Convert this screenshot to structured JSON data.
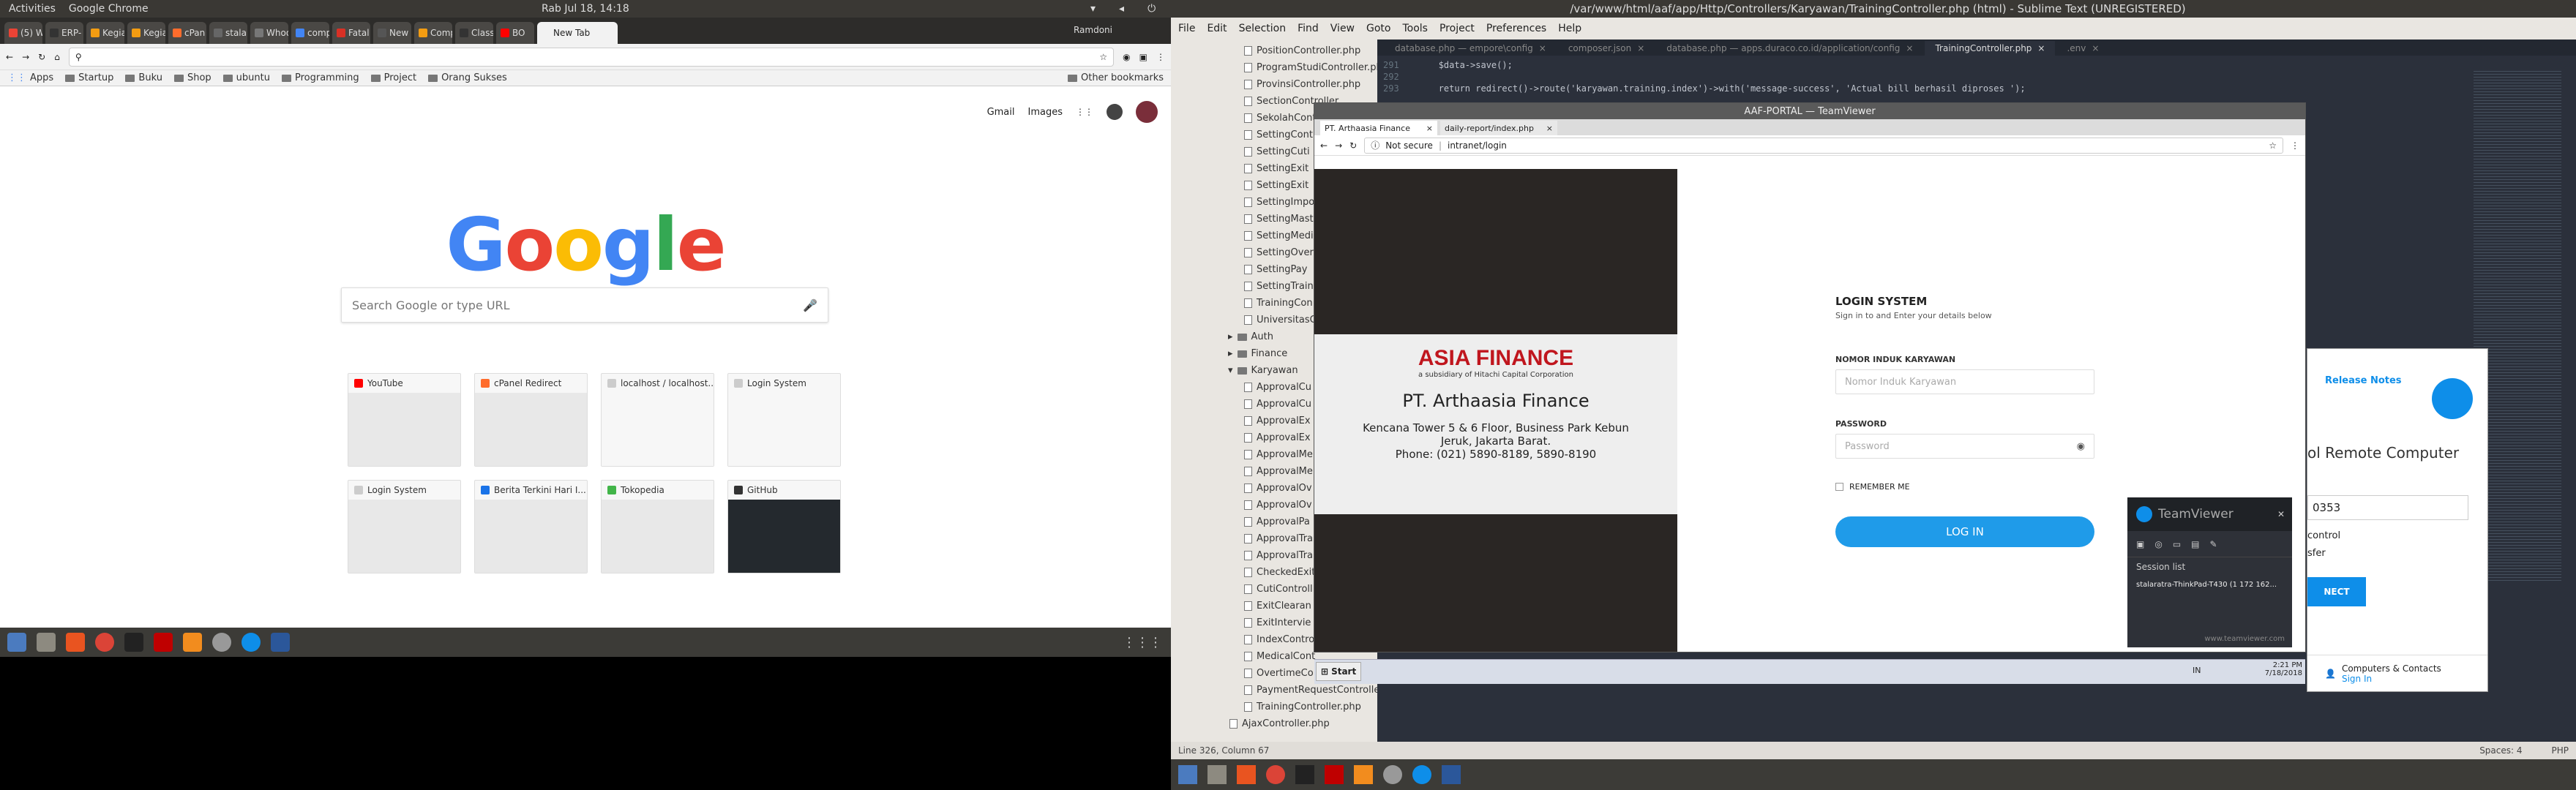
{
  "left": {
    "topbar": {
      "activities": "Activities",
      "app": "Google Chrome",
      "clock": "Rab Jul 18, 14:18"
    },
    "tabs": [
      {
        "label": "(5) W",
        "color": "#ea4335"
      },
      {
        "label": "ERP-",
        "color": "#333333"
      },
      {
        "label": "Kegia",
        "color": "#f39c12"
      },
      {
        "label": "Kegia",
        "color": "#f39c12"
      },
      {
        "label": "cPan",
        "color": "#ff6c2c"
      },
      {
        "label": "stalar",
        "color": "#666666"
      },
      {
        "label": "Whoo",
        "color": "#777777"
      },
      {
        "label": "comp",
        "color": "#4285f4"
      },
      {
        "label": "Fatal",
        "color": "#d93025"
      },
      {
        "label": "New t",
        "color": "#555555"
      },
      {
        "label": "Comp",
        "color": "#f39c12"
      },
      {
        "label": "Class",
        "color": "#333333"
      },
      {
        "label": "BO",
        "color": "#ff0000"
      },
      {
        "label": "New Tab",
        "color": "#f2f2f2",
        "active": true
      }
    ],
    "profile": "Ramdoni",
    "bookmarks": [
      "Apps",
      "Startup",
      "Buku",
      "Shop",
      "ubuntu",
      "Programming",
      "Project",
      "Orang Sukses"
    ],
    "other_bookmarks": "Other bookmarks",
    "ntp": {
      "gmail": "Gmail",
      "images": "Images",
      "logo": [
        "G",
        "o",
        "o",
        "g",
        "l",
        "e"
      ],
      "logo_colors": [
        "#4285f4",
        "#ea4335",
        "#fbbc05",
        "#4285f4",
        "#34a853",
        "#ea4335"
      ],
      "search_placeholder": "Search Google or type URL",
      "tiles": [
        {
          "title": "YouTube",
          "fav": "#ff0000"
        },
        {
          "title": "cPanel Redirect",
          "fav": "#ff6c2c"
        },
        {
          "title": "localhost / localhost...",
          "fav": "#cccccc"
        },
        {
          "title": "Login System",
          "fav": "#cccccc"
        },
        {
          "title": "Login System",
          "fav": "#cccccc"
        },
        {
          "title": "Berita Terkini Hari I...",
          "fav": "#1a73e8"
        },
        {
          "title": "Tokopedia",
          "fav": "#42b549"
        },
        {
          "title": "GitHub",
          "fav": "#333333"
        }
      ]
    }
  },
  "right": {
    "title": "/var/www/html/aaf/app/Http/Controllers/Karyawan/TrainingController.php (html) - Sublime Text (UNREGISTERED)",
    "menu": [
      "File",
      "Edit",
      "Selection",
      "Find",
      "View",
      "Goto",
      "Tools",
      "Project",
      "Preferences",
      "Help"
    ],
    "sidebar_files_top": [
      "PositionController.php",
      "ProgramStudiController.php",
      "ProvinsiController.php",
      "SectionController",
      "SekolahCont",
      "SettingCont",
      "SettingCuti",
      "SettingExit",
      "SettingExit",
      "SettingImpo",
      "SettingMast",
      "SettingMedi",
      "SettingOver",
      "SettingPay",
      "SettingTrain",
      "TrainingCon",
      "UniversitasC"
    ],
    "sidebar_folders": [
      "Auth",
      "Finance",
      "Karyawan"
    ],
    "sidebar_files_bottom": [
      "ApprovalCu",
      "ApprovalCu",
      "ApprovalEx",
      "ApprovalEx",
      "ApprovalMe",
      "ApprovalMe",
      "ApprovalOv",
      "ApprovalOv",
      "ApprovalPa",
      "ApprovalTra",
      "ApprovalTra",
      "CheckedExit",
      "CutiControll",
      "ExitClearan",
      "ExitIntervie",
      "IndexContro",
      "MedicalCont",
      "OvertimeCo",
      "PaymentRequestControlle",
      "TrainingController.php",
      "AjaxController.php"
    ],
    "editor_tabs": [
      "database.php — empore\\config",
      "composer.json",
      "database.php — apps.duraco.co.id/application/config",
      "TrainingController.php",
      ".env"
    ],
    "code_lines": [
      {
        "num": "291",
        "text": "$data->save();"
      },
      {
        "num": "292",
        "text": ""
      },
      {
        "num": "293",
        "text": "return redirect()->route('karyawan.training.index')->with('message-success', 'Actual bill berhasil diproses ');"
      }
    ],
    "statusbar": {
      "position": "Line 326, Column 67",
      "spaces": "Spaces: 4",
      "syntax": "PHP"
    },
    "teamviewer": {
      "title": "AAF-PORTAL — TeamViewer",
      "browser_tabs": [
        "PT. Arthaasia Finance",
        "daily-report/index.php"
      ],
      "not_secure": "Not secure",
      "url": "intranet/login",
      "company_logo": "ASIA FINANCE",
      "company_sub": "a subsidiary of Hitachi Capital Corporation",
      "company_name": "PT. Arthaasia Finance",
      "address1": "Kencana Tower 5 & 6 Floor, Business Park Kebun",
      "address2": "Jeruk, Jakarta Barat.",
      "phone": "Phone: (021) 5890-8189, 5890-8190",
      "login_title": "LOGIN SYSTEM",
      "login_sub": "Sign in to and Enter your details below",
      "nik_label": "NOMOR INDUK KARYAWAN",
      "nik_placeholder": "Nomor Induk Karyawan",
      "pw_label": "PASSWORD",
      "pw_placeholder": "Password",
      "remember": "REMEMBER ME",
      "login_btn": "LOG IN",
      "xp_start": "Start",
      "xp_lang": "IN",
      "xp_time": "2:21 PM",
      "xp_date": "7/18/2018",
      "panel_release": "Release Notes",
      "panel_heading": "ol Remote Computer",
      "panel_id": "0353",
      "panel_control": "control",
      "panel_transfer": "sfer",
      "panel_connect": "NECT",
      "panel_contacts": "Computers & Contacts",
      "panel_signin": "Sign In",
      "small_title": "TeamViewer",
      "small_session": "Session list",
      "small_session_item": "stalaratra-ThinkPad-T430 (1 172 162...",
      "small_link": "www.teamviewer.com"
    }
  }
}
